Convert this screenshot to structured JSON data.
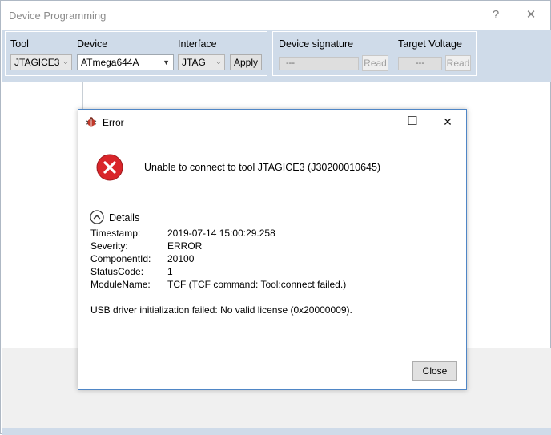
{
  "window": {
    "title": "Device Programming",
    "help_glyph": "?",
    "close_glyph": "✕"
  },
  "toolbar": {
    "tool": {
      "label": "Tool",
      "value": "JTAGICE3"
    },
    "device": {
      "label": "Device",
      "value": "ATmega644A"
    },
    "interface": {
      "label": "Interface",
      "value": "JTAG",
      "apply_label": "Apply"
    },
    "signature": {
      "label": "Device signature",
      "value": "---",
      "read_label": "Read"
    },
    "voltage": {
      "label": "Target Voltage",
      "value": "---",
      "read_label": "Read"
    }
  },
  "dialog": {
    "title": "Error",
    "minimize_glyph": "—",
    "maximize_glyph": "☐",
    "close_glyph": "✕",
    "message": "Unable to connect to tool JTAGICE3 (J30200010645)",
    "details_label": "Details",
    "details": [
      {
        "key": "Timestamp:",
        "value": "2019-07-14 15:00:29.258"
      },
      {
        "key": "Severity:",
        "value": "ERROR"
      },
      {
        "key": "ComponentId:",
        "value": "20100"
      },
      {
        "key": "StatusCode:",
        "value": "1"
      },
      {
        "key": "ModuleName:",
        "value": "TCF (TCF command: Tool:connect failed.)"
      }
    ],
    "extra_message": "USB driver initialization failed: No valid license (0x20000009).",
    "close_label": "Close"
  },
  "colors": {
    "toolbar_bg": "#cfdbe9",
    "dialog_border": "#4f86c6",
    "error_red": "#d9252a"
  },
  "icons": {
    "app": "bug-icon",
    "error": "error-x-icon",
    "details": "chevron-up-circle-icon"
  }
}
